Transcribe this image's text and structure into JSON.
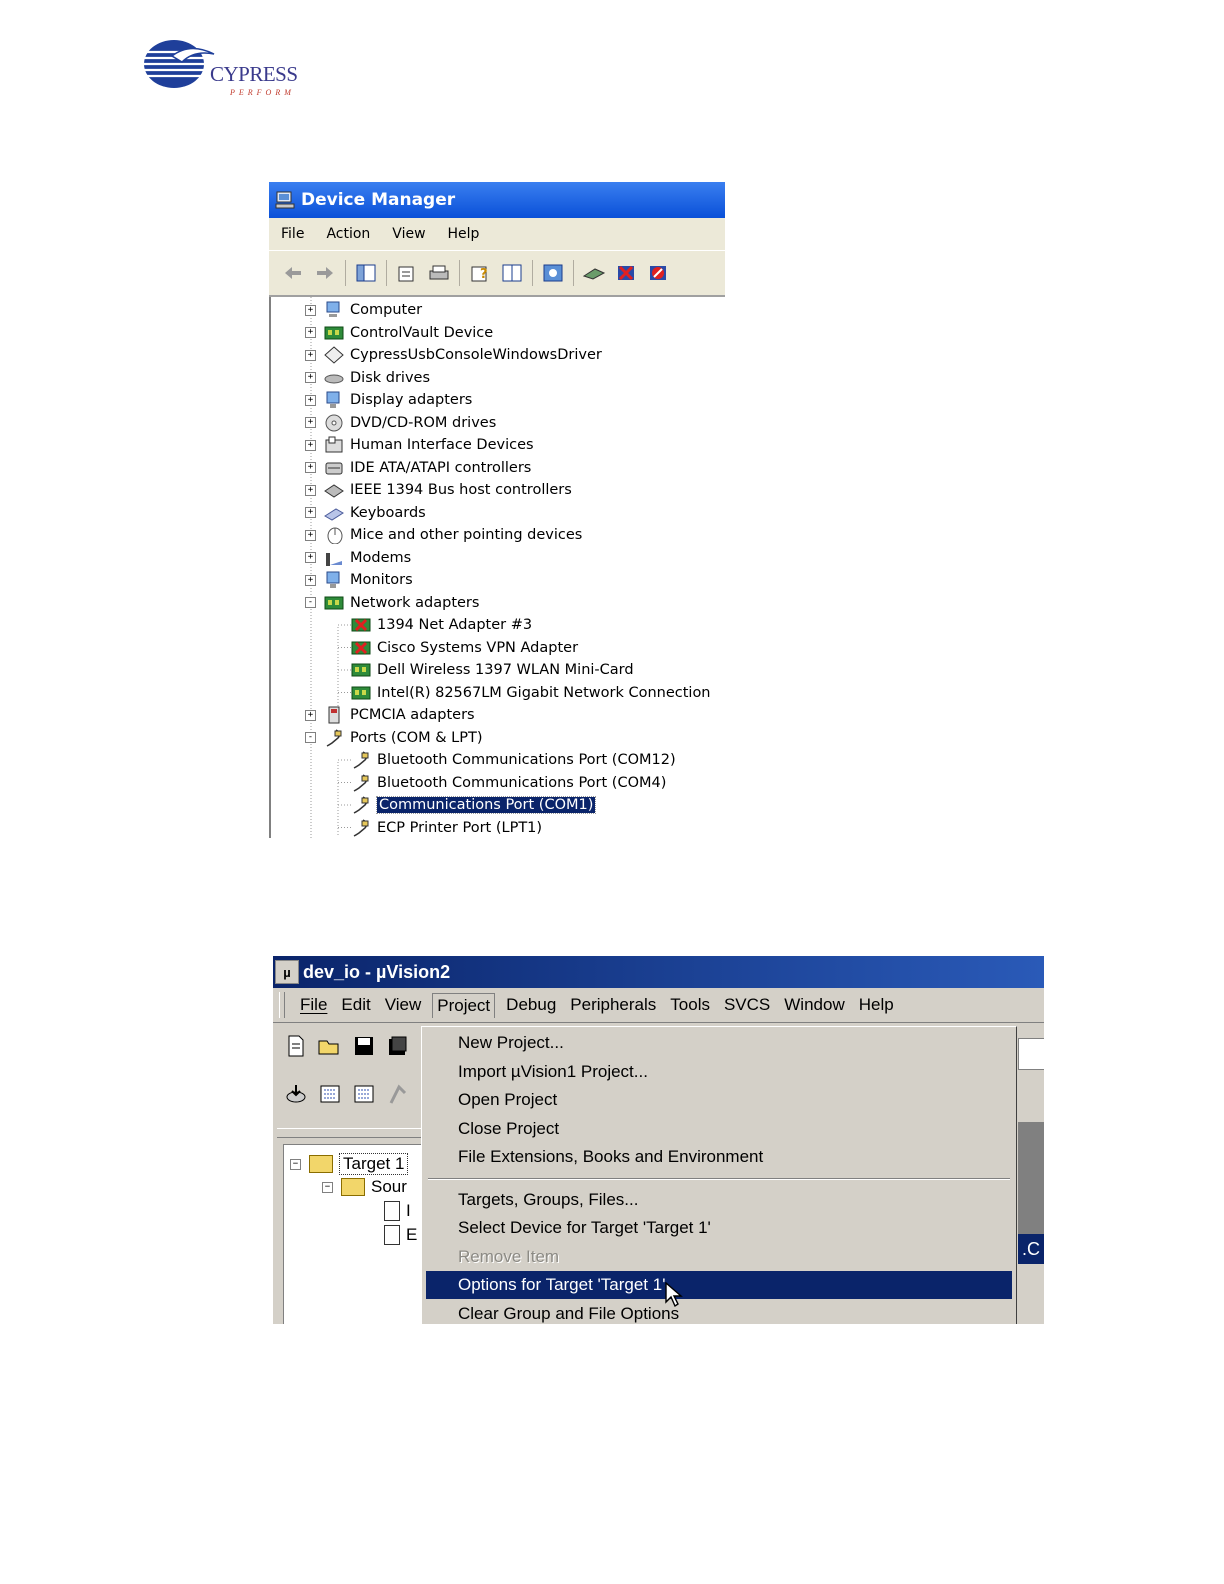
{
  "logo": {
    "company": "CYPRESS",
    "tagline": "PERFORM"
  },
  "device_manager": {
    "title": "Device Manager",
    "menu": [
      "File",
      "Action",
      "View",
      "Help"
    ],
    "toolbar_icons": [
      "back-icon",
      "forward-icon",
      "show-hide-tree-icon",
      "properties-icon",
      "print-icon",
      "help-icon",
      "console-icon",
      "scan-hardware-icon",
      "update-driver-icon",
      "uninstall-icon",
      "disable-icon"
    ],
    "tree": [
      {
        "label": "Computer",
        "icon": "computer-icon",
        "level": 0,
        "expander": "+"
      },
      {
        "label": "ControlVault Device",
        "icon": "board-icon",
        "level": 0,
        "expander": "+"
      },
      {
        "label": "CypressUsbConsoleWindowsDriver",
        "icon": "diamond-icon",
        "level": 0,
        "expander": "+"
      },
      {
        "label": "Disk drives",
        "icon": "disk-icon",
        "level": 0,
        "expander": "+"
      },
      {
        "label": "Display adapters",
        "icon": "display-icon",
        "level": 0,
        "expander": "+"
      },
      {
        "label": "DVD/CD-ROM drives",
        "icon": "cdrom-icon",
        "level": 0,
        "expander": "+"
      },
      {
        "label": "Human Interface Devices",
        "icon": "hid-icon",
        "level": 0,
        "expander": "+"
      },
      {
        "label": "IDE ATA/ATAPI controllers",
        "icon": "ide-icon",
        "level": 0,
        "expander": "+"
      },
      {
        "label": "IEEE 1394 Bus host controllers",
        "icon": "firewire-icon",
        "level": 0,
        "expander": "+"
      },
      {
        "label": "Keyboards",
        "icon": "keyboard-icon",
        "level": 0,
        "expander": "+"
      },
      {
        "label": "Mice and other pointing devices",
        "icon": "mouse-icon",
        "level": 0,
        "expander": "+"
      },
      {
        "label": "Modems",
        "icon": "modem-icon",
        "level": 0,
        "expander": "+"
      },
      {
        "label": "Monitors",
        "icon": "monitor-icon",
        "level": 0,
        "expander": "+"
      },
      {
        "label": "Network adapters",
        "icon": "network-icon",
        "level": 0,
        "expander": "-"
      },
      {
        "label": "1394 Net Adapter #3",
        "icon": "network-disabled-icon",
        "level": 1
      },
      {
        "label": "Cisco Systems VPN Adapter",
        "icon": "network-disabled-icon",
        "level": 1
      },
      {
        "label": "Dell Wireless 1397 WLAN Mini-Card",
        "icon": "network-icon",
        "level": 1
      },
      {
        "label": "Intel(R) 82567LM Gigabit Network Connection",
        "icon": "network-icon",
        "level": 1
      },
      {
        "label": "PCMCIA adapters",
        "icon": "pcmcia-icon",
        "level": 0,
        "expander": "+"
      },
      {
        "label": "Ports (COM & LPT)",
        "icon": "port-icon",
        "level": 0,
        "expander": "-"
      },
      {
        "label": "Bluetooth Communications Port (COM12)",
        "icon": "port-icon",
        "level": 1
      },
      {
        "label": "Bluetooth Communications Port (COM4)",
        "icon": "port-icon",
        "level": 1
      },
      {
        "label": "Communications Port (COM1)",
        "icon": "port-icon",
        "level": 1,
        "selected": true
      },
      {
        "label": "ECP Printer Port (LPT1)",
        "icon": "port-icon",
        "level": 1
      }
    ]
  },
  "uvision": {
    "title": "dev_io  - µVision2",
    "menu": [
      "File",
      "Edit",
      "View",
      "Project",
      "Debug",
      "Peripherals",
      "Tools",
      "SVCS",
      "Window",
      "Help"
    ],
    "open_menu": "Project",
    "tree": {
      "target": "Target 1",
      "source_group": "Sour",
      "file1": "I",
      "file2": "E"
    },
    "right_partial": ".C",
    "project_menu": [
      {
        "label": "New Project...",
        "enabled": true
      },
      {
        "label": "Import µVision1 Project...",
        "enabled": true
      },
      {
        "label": "Open Project",
        "enabled": true
      },
      {
        "label": "Close Project",
        "enabled": true
      },
      {
        "label": "File Extensions, Books and Environment",
        "enabled": true
      },
      {
        "separator": true
      },
      {
        "label": "Targets, Groups, Files...",
        "enabled": true
      },
      {
        "label": "Select Device for Target 'Target 1'",
        "enabled": true
      },
      {
        "label": "Remove Item",
        "enabled": false
      },
      {
        "label": "Options for Target 'Target 1'",
        "enabled": true,
        "highlighted": true
      },
      {
        "label": "Clear Group and File Options",
        "enabled": true
      }
    ]
  },
  "colors": {
    "xp_title": "#0a50d8",
    "selection": "#0a246a",
    "classic_face": "#d4d0c8"
  }
}
